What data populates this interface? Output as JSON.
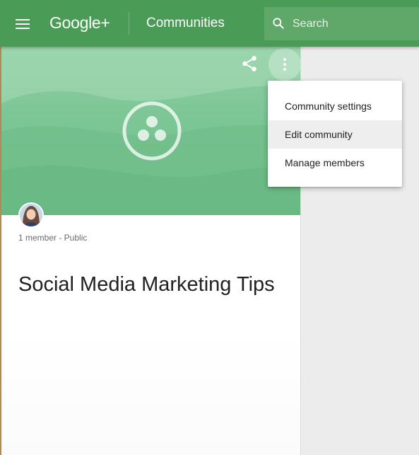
{
  "header": {
    "logo": "Google+",
    "title": "Communities",
    "search_placeholder": "Search",
    "bar_color": "#4a9b56"
  },
  "community": {
    "meta": "1 member - Public",
    "name": "Social Media Marketing Tips",
    "cover_color": "#7cc595",
    "actions": {
      "share_icon": "share-icon",
      "more_icon": "more-vert-icon"
    }
  },
  "menu": {
    "items": [
      {
        "label": "Community settings",
        "active": false
      },
      {
        "label": "Edit community",
        "active": true
      },
      {
        "label": "Manage members",
        "active": false
      }
    ]
  }
}
